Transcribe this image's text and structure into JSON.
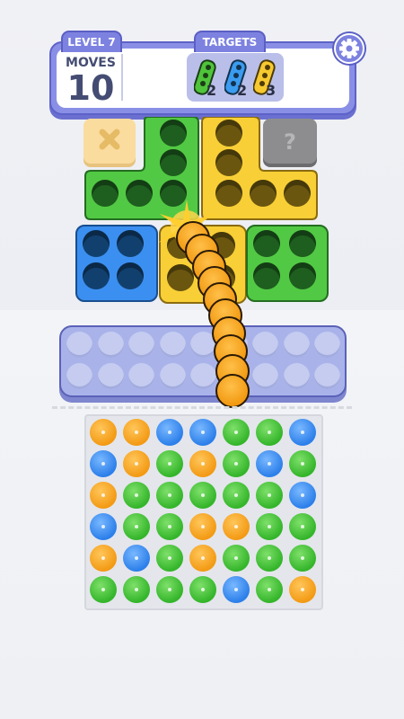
{
  "header": {
    "level_label": "LEVEL 7",
    "targets_label": "TARGETS",
    "moves_label": "MOVES",
    "moves_value": "10",
    "targets": [
      {
        "color": "#4fc43b",
        "count": "2"
      },
      {
        "color": "#3a9cf0",
        "count": "2"
      },
      {
        "color": "#f7c930",
        "count": "3"
      }
    ]
  },
  "icons": {
    "settings": "gear-icon",
    "locked_slot": "x-icon",
    "unknown_slot": "question-icon"
  },
  "colors": {
    "green": "#52c944",
    "yellow": "#f8cf36",
    "blue": "#3b8ff0",
    "orange": "#f8a623",
    "tray": "#a9b3ea",
    "accent": "#7d82e0"
  },
  "board_grid": [
    [
      "orange",
      "orange",
      "blue",
      "blue",
      "green",
      "green",
      "blue"
    ],
    [
      "blue",
      "orange",
      "green",
      "orange",
      "green",
      "blue",
      "green"
    ],
    [
      "orange",
      "green",
      "green",
      "green",
      "green",
      "green",
      "blue"
    ],
    [
      "blue",
      "green",
      "green",
      "orange",
      "orange",
      "green",
      "green"
    ],
    [
      "orange",
      "blue",
      "green",
      "orange",
      "green",
      "green",
      "green"
    ],
    [
      "green",
      "green",
      "green",
      "green",
      "blue",
      "green",
      "orange"
    ]
  ]
}
